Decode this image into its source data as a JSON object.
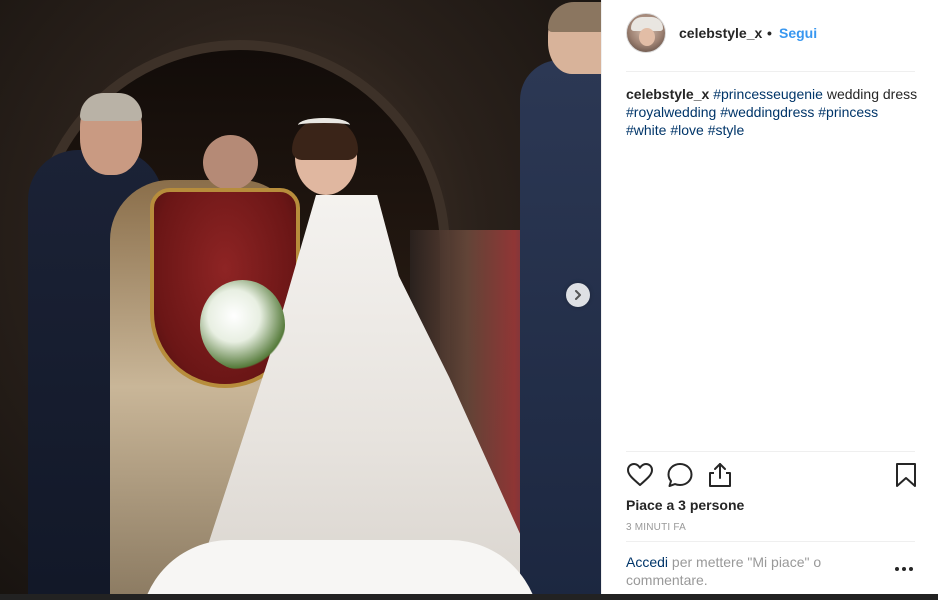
{
  "photo": {
    "alt": "",
    "next_icon": "chevron-right-icon"
  },
  "post": {
    "username": "celebstyle_x",
    "separator": "•",
    "follow_label": "Segui",
    "caption": {
      "user": "celebstyle_x",
      "tags": [
        "#princesseugenie",
        "#royalwedding",
        "#weddingdress",
        "#princess",
        "#white",
        "#love",
        "#style"
      ],
      "text_after_first_tag": "wedding dress"
    },
    "likes_text": "Piace a 3 persone",
    "time_ago": "3 MINUTI FA",
    "login_link": "Accedi",
    "login_text": "per mettere \"Mi piace\" o commentare."
  },
  "icons": {
    "like": "heart-icon",
    "comment": "comment-icon",
    "share": "share-icon",
    "save": "bookmark-icon",
    "more": "more-options-icon"
  },
  "colors": {
    "link_blue": "#3897f0",
    "hashtag_blue": "#003569",
    "muted_gray": "#999999",
    "text_dark": "#262626"
  }
}
